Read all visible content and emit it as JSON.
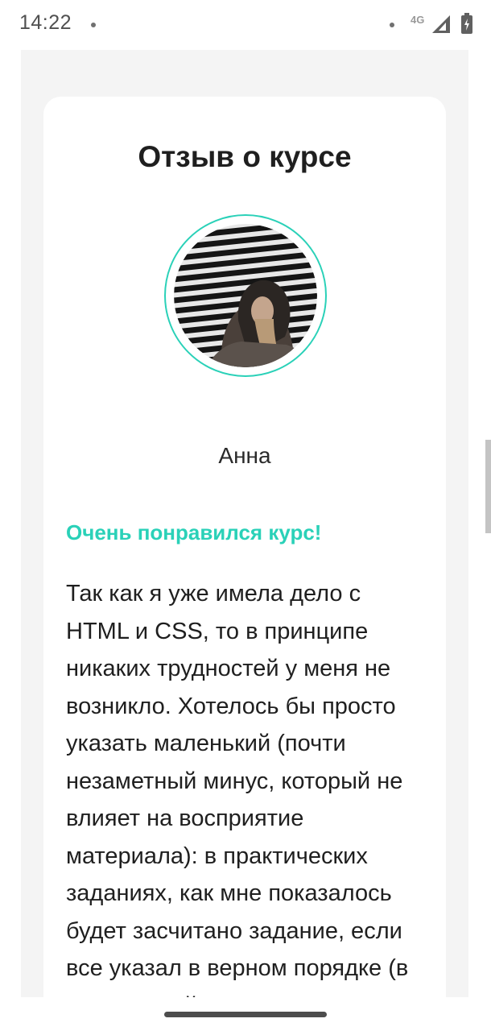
{
  "status_bar": {
    "time": "14:22",
    "network": "4G",
    "icons": [
      "notification-dot-icon",
      "signal-icon",
      "battery-icon"
    ]
  },
  "review": {
    "title": "Отзыв о курсе",
    "author": "Анна",
    "headline": "Очень понравился курс!",
    "body": "Так как я уже имела дело с HTML и CSS, то в принципе никаких трудностей у меня не возникло. Хотелось бы просто указать маленький (почти незаметный минус, который не влияет на восприятие материала): в практических заданиях, как мне показалось будет засчитано задание, если все указал в верном порядке (в случае свойств это сделать"
  },
  "colors": {
    "accent": "#2ad1b8",
    "page_background": "#f4f4f4",
    "card_background": "#ffffff",
    "text": "#1f1f1f"
  }
}
